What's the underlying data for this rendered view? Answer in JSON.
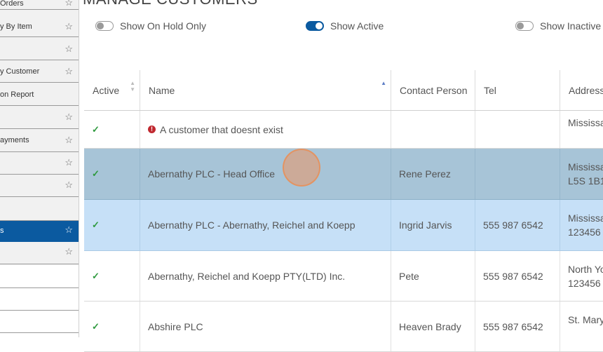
{
  "page_title": "MANAGE CUSTOMERS",
  "sidebar": {
    "items": [
      {
        "label": "Orders",
        "star": "☆"
      },
      {
        "label": "y By Item",
        "star": "☆"
      },
      {
        "label": "",
        "star": "☆"
      },
      {
        "label": "y Customer",
        "star": "☆"
      },
      {
        "label": "on Report",
        "star": ""
      },
      {
        "label": "",
        "star": "☆"
      },
      {
        "label": "ayments",
        "star": "☆"
      },
      {
        "label": "",
        "star": "☆"
      },
      {
        "label": "",
        "star": "☆"
      },
      {
        "label": "",
        "star": ""
      },
      {
        "label": "s",
        "star": "☆"
      },
      {
        "label": "",
        "star": "☆"
      }
    ]
  },
  "toggles": [
    {
      "label": "Show On Hold Only",
      "on": false
    },
    {
      "label": "Show Active",
      "on": true
    },
    {
      "label": "Show Inactive",
      "on": false
    }
  ],
  "table": {
    "columns": [
      "Active",
      "Name",
      "Contact Person",
      "Tel",
      "Address"
    ],
    "sorted_column": "Name",
    "rows": [
      {
        "active": "✓",
        "name": "A customer that doesnt exist",
        "error": true,
        "contact": "",
        "tel": "",
        "address": [
          "",
          "Mississau"
        ]
      },
      {
        "active": "✓",
        "name": "Abernathy PLC - Head Office",
        "error": false,
        "contact": "Rene Perez",
        "tel": "",
        "address": [
          "Mississau",
          "L5S 1B1"
        ]
      },
      {
        "active": "✓",
        "name": "Abernathy PLC - Abernathy, Reichel and Koepp",
        "error": false,
        "contact": "Ingrid Jarvis",
        "tel": "555 987 6542",
        "address": [
          "Mississau",
          "123456"
        ]
      },
      {
        "active": "✓",
        "name": "Abernathy, Reichel and Koepp PTY(LTD) Inc.",
        "error": false,
        "contact": "Pete",
        "tel": "555 987 6542",
        "address": [
          "North Yo",
          "123456"
        ]
      },
      {
        "active": "✓",
        "name": "Abshire PLC",
        "error": false,
        "contact": "Heaven Brady",
        "tel": "555 987 6542",
        "address": [
          "St. Mary",
          ""
        ]
      }
    ]
  },
  "colors": {
    "sidebar_active": "#0b5aa0",
    "row_selected_dark": "#a7c4d7",
    "row_selected_light": "#c6e0f7",
    "check_green": "#2f9a3f",
    "error_red": "#c0282f"
  }
}
